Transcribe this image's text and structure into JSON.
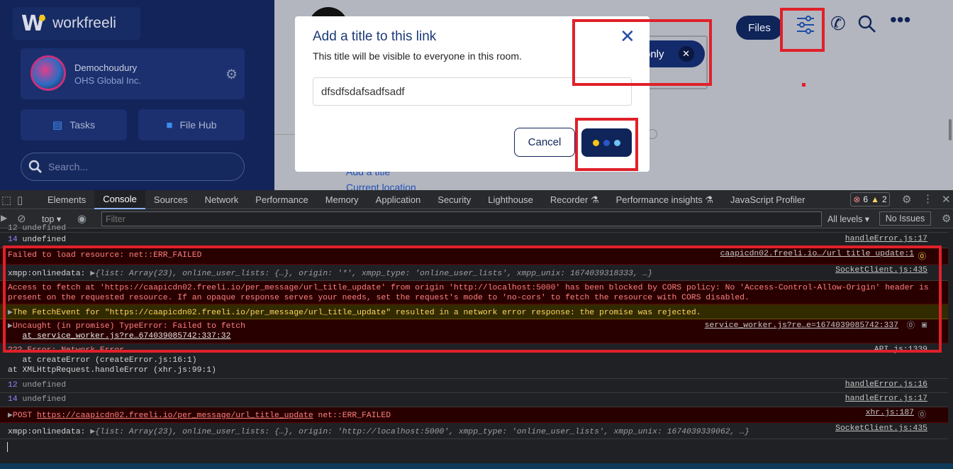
{
  "sidebar": {
    "logo_text": "workfreeli",
    "user_name": "Demochoudury",
    "user_org": "OHS Global Inc.",
    "tasks_label": "Tasks",
    "filehub_label": "File Hub",
    "search_placeholder": "Search..."
  },
  "header": {
    "files_label": "Files",
    "pill_label": "only"
  },
  "main": {
    "add_title_link": "Add a title",
    "current_location": "Current location"
  },
  "dialog": {
    "title": "Add a title to this link",
    "subtitle": "This title will be visible to everyone in this room.",
    "input_value": "dfsdfsdafsadfsadf",
    "cancel_label": "Cancel",
    "loading_dot_colors": [
      "#f5c518",
      "#2a57c9",
      "#6fc3f5"
    ]
  },
  "devtools": {
    "tabs": [
      "Elements",
      "Console",
      "Sources",
      "Network",
      "Performance",
      "Memory",
      "Application",
      "Security",
      "Lighthouse",
      "Recorder ⚗",
      "Performance insights ⚗",
      "JavaScript Profiler"
    ],
    "active_tab": "Console",
    "errors_count": "6",
    "warnings_count": "2",
    "context": "top",
    "filter_placeholder": "Filter",
    "levels_label": "All levels ▾",
    "issues_label": "No Issues"
  },
  "console": {
    "partial_top": "12 undefined",
    "row1_num": "14",
    "row1_text": "undefined",
    "row1_src": "handleError.js:17",
    "row2_text": "Failed to load resource: net::ERR_FAILED",
    "row2_src": "caapicdn02.freeli.io…/url title update:1",
    "row3_label": "xmpp:onlinedata:",
    "row3_text": "{list: Array(23), online_user_lists: {…}, origin: '*', xmpp_type: 'online_user_lists', xmpp_unix: 1674039318333, …}",
    "row3_src": "SocketClient.js:435",
    "row4_line1": "Access to fetch at 'https://caapicdn02.freeli.io/per_message/url_title_update' from origin 'http://localhost:5000' has been blocked by CORS policy: No 'Access-Control-Allow-Origin' header is",
    "row4_line2": "present on the requested resource. If an opaque response serves your needs, set the request's mode to 'no-cors' to fetch the resource with CORS disabled.",
    "row5_text": "The FetchEvent for \"https://caapicdn02.freeli.io/per_message/url_title_update\" resulted in a network error response: the promise was rejected.",
    "row6_line1": "Uncaught (in promise) TypeError: Failed to fetch",
    "row6_line2": "at service_worker.js?re…674039085742:337:32",
    "row6_src": "service_worker.js?re…e=1674039085742:337",
    "row7_partial": "??? Error: Network Error",
    "row7_src": "API.js:1339",
    "row7_line2": "at createError (createError.js:16:1)",
    "row7_line3": "at XMLHttpRequest.handleError (xhr.js:99:1)",
    "row8_num": "12",
    "row8_text": "undefined",
    "row8_src": "handleError.js:16",
    "row9_num": "14",
    "row9_text": "undefined",
    "row9_src": "handleError.js:17",
    "row10_method": "POST",
    "row10_url": "https://caapicdn02.freeli.io/per_message/url_title_update",
    "row10_err": "net::ERR_FAILED",
    "row10_src": "xhr.js:187",
    "row11_label": "xmpp:onlinedata:",
    "row11_text": "{list: Array(23), online_user_lists: {…}, origin: 'http://localhost:5000', xmpp_type: 'online_user_lists', xmpp_unix: 1674039339062, …}",
    "row11_src": "SocketClient.js:435"
  }
}
